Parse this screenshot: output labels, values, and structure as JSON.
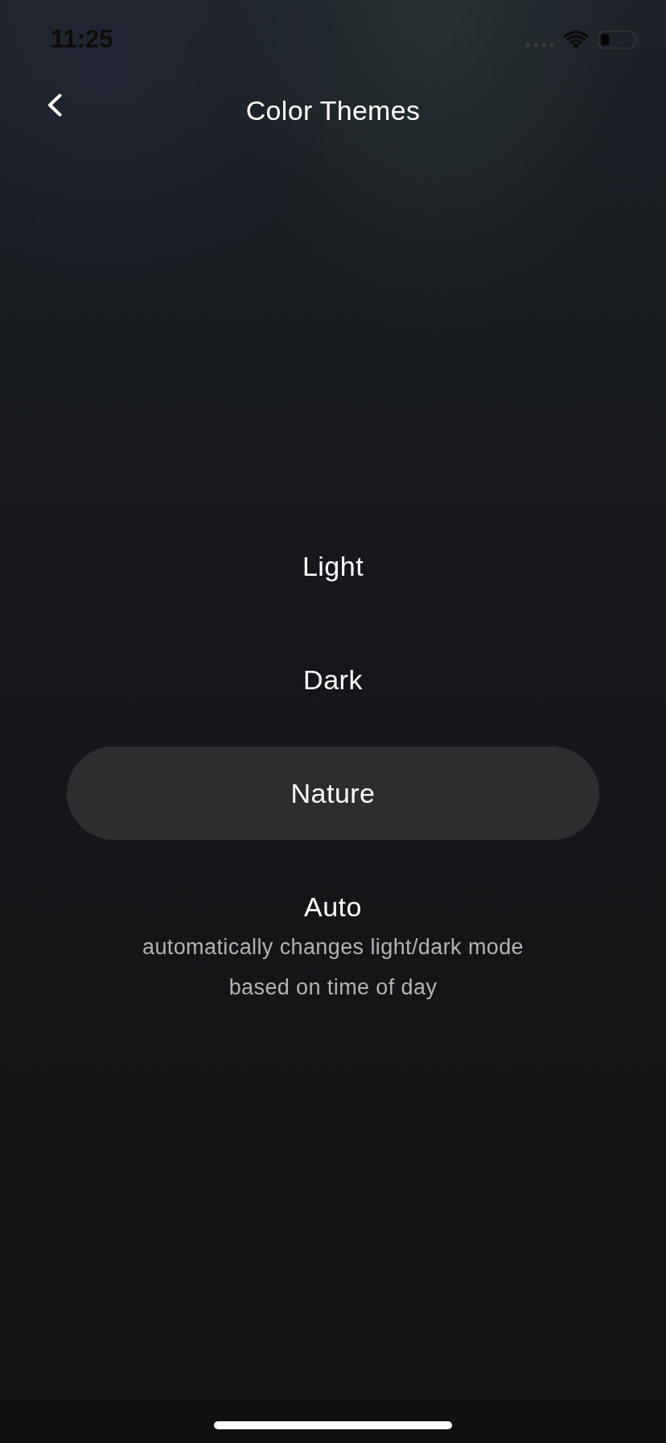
{
  "status_bar": {
    "time": "11:25"
  },
  "header": {
    "title": "Color Themes"
  },
  "themes": [
    {
      "label": "Light",
      "selected": false
    },
    {
      "label": "Dark",
      "selected": false
    },
    {
      "label": "Nature",
      "selected": true
    },
    {
      "label": "Auto",
      "selected": false,
      "description": "automatically changes light/dark mode based on time of day"
    }
  ]
}
